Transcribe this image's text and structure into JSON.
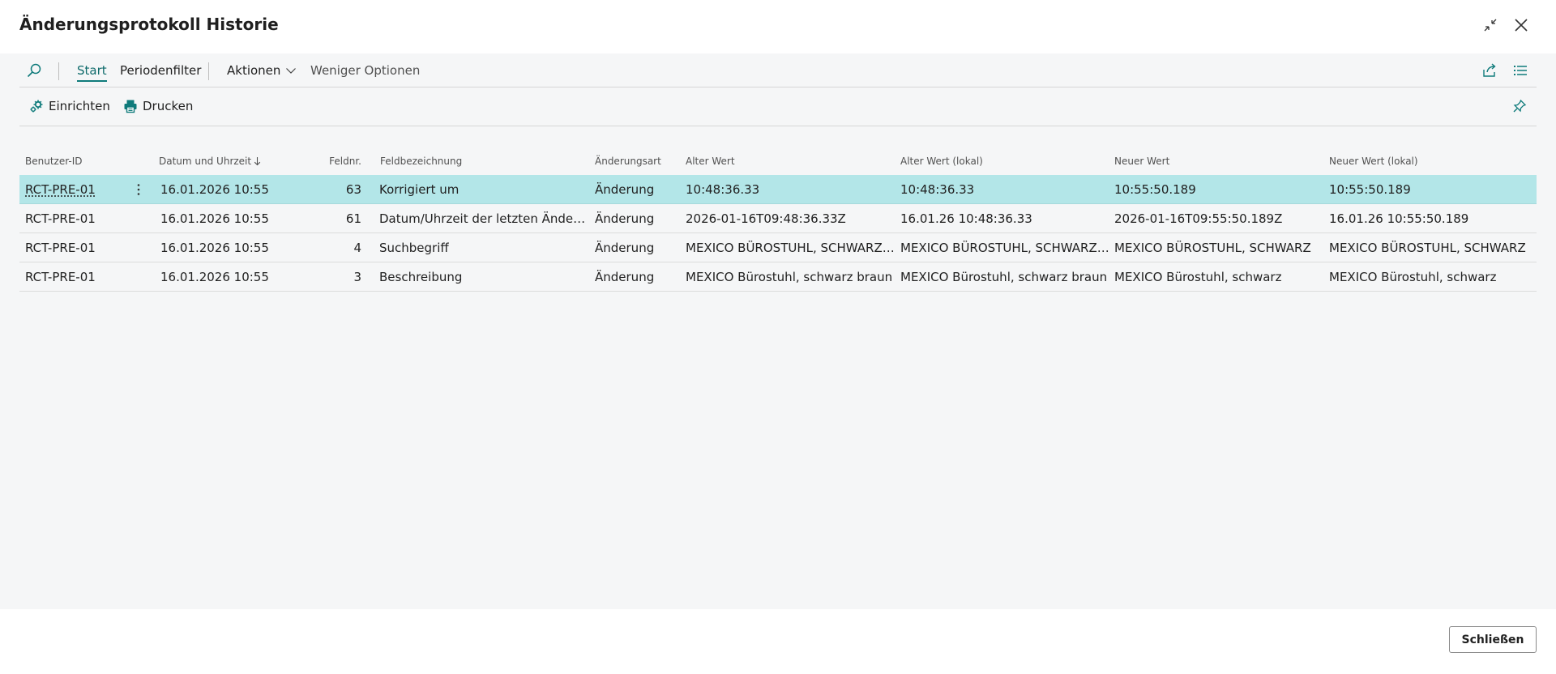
{
  "dialog": {
    "title": "Änderungsprotokoll Historie"
  },
  "actionbar": {
    "start_label": "Start",
    "periodenfilter_label": "Periodenfilter",
    "aktionen_label": "Aktionen",
    "weniger_label": "Weniger Optionen"
  },
  "subbar": {
    "einrichten_label": "Einrichten",
    "drucken_label": "Drucken"
  },
  "table": {
    "headers": {
      "user": "Benutzer-ID",
      "date": "Datum und Uhrzeit",
      "feld": "Feldnr.",
      "bez": "Feldbezeichnung",
      "art": "Änderungsart",
      "alt": "Alter Wert",
      "altl": "Alter Wert (lokal)",
      "neu": "Neuer Wert",
      "neul": "Neuer Wert (lokal)"
    },
    "rows": [
      {
        "user": "RCT-PRE-01",
        "date": "16.01.2026 10:55",
        "feld": "63",
        "bez": "Korrigiert um",
        "art": "Änderung",
        "alt": "10:48:36.33",
        "altl": "10:48:36.33",
        "neu": "10:55:50.189",
        "neul": "10:55:50.189"
      },
      {
        "user": "RCT-PRE-01",
        "date": "16.01.2026 10:55",
        "feld": "61",
        "bez": "Datum/Uhrzeit der letzten Änderung",
        "art": "Änderung",
        "alt": "2026-01-16T09:48:36.33Z",
        "altl": "16.01.26 10:48:36.33",
        "neu": "2026-01-16T09:55:50.189Z",
        "neul": "16.01.26 10:55:50.189"
      },
      {
        "user": "RCT-PRE-01",
        "date": "16.01.2026 10:55",
        "feld": "4",
        "bez": "Suchbegriff",
        "art": "Änderung",
        "alt": "MEXICO BÜROSTUHL, SCHWARZ BRA...",
        "altl": "MEXICO BÜROSTUHL, SCHWARZ BRA...",
        "neu": "MEXICO BÜROSTUHL, SCHWARZ",
        "neul": "MEXICO BÜROSTUHL, SCHWARZ"
      },
      {
        "user": "RCT-PRE-01",
        "date": "16.01.2026 10:55",
        "feld": "3",
        "bez": "Beschreibung",
        "art": "Änderung",
        "alt": "MEXICO Bürostuhl, schwarz braun",
        "altl": "MEXICO Bürostuhl, schwarz braun",
        "neu": "MEXICO Bürostuhl, schwarz",
        "neul": "MEXICO Bürostuhl, schwarz"
      }
    ]
  },
  "footer": {
    "close_label": "Schließen"
  },
  "colors": {
    "accent": "#0f7b7b",
    "selected_row": "#b3e6e8",
    "content_bg": "#f5f6f7"
  },
  "icons": {
    "search": "search-icon",
    "collapse": "collapse-icon",
    "close": "close-icon",
    "share": "share-icon",
    "list": "list-view-icon",
    "setup": "setup-icon",
    "print": "printer-icon",
    "pin": "pin-icon",
    "sort": "sort-down-arrow-icon"
  }
}
